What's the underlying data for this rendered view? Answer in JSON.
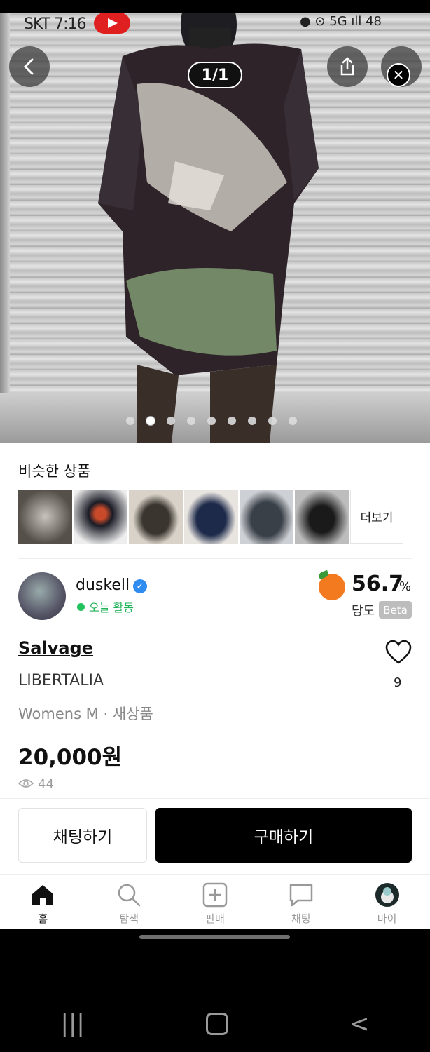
{
  "status_bar": {
    "carrier_time": "SKT 7:16",
    "battery": "48"
  },
  "hero": {
    "pager": "1/1",
    "slides": 9,
    "active_slide": 2
  },
  "similar": {
    "title": "비슷한 상품",
    "more_label": "더보기"
  },
  "seller": {
    "name": "duskell",
    "activity": "오늘 활동",
    "score": "56.7",
    "score_unit": "%",
    "score_label": "당도",
    "beta": "Beta"
  },
  "product": {
    "brand": "Salvage",
    "sub_brand": "LIBERTALIA",
    "meta": "Womens M · 새상품",
    "price": "20,000원",
    "views": "44",
    "likes": "9"
  },
  "actions": {
    "chat": "채팅하기",
    "buy": "구매하기"
  },
  "tabbar": [
    {
      "label": "홈",
      "icon": "home-icon"
    },
    {
      "label": "탐색",
      "icon": "search-icon"
    },
    {
      "label": "판매",
      "icon": "plus-square-icon"
    },
    {
      "label": "채팅",
      "icon": "chat-bubble-icon"
    },
    {
      "label": "마이",
      "icon": "profile-icon"
    }
  ]
}
